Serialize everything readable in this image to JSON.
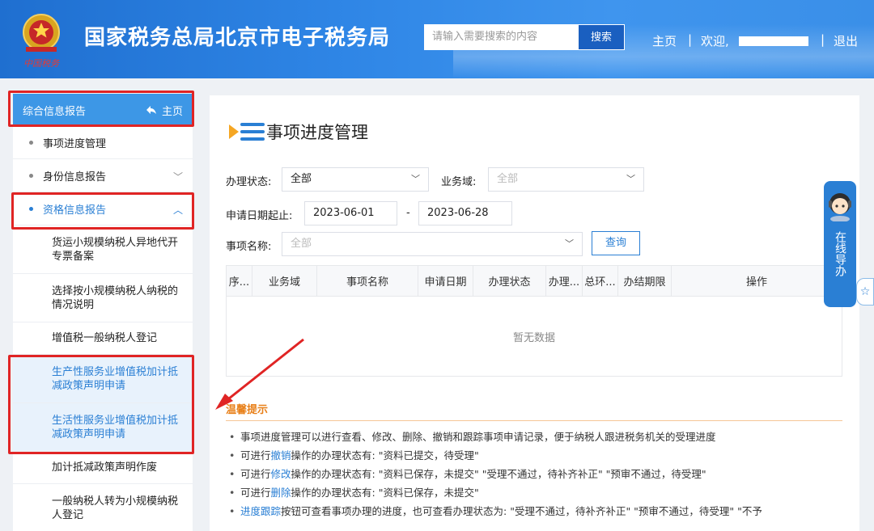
{
  "header": {
    "title": "国家税务总局北京市电子税务局",
    "search_placeholder": "请输入需要搜索的内容",
    "search_button": "搜索",
    "nav_home": "主页",
    "nav_sep": "|",
    "nav_welcome": "欢迎,",
    "nav_logout": "退出",
    "logo_text": "中国税务"
  },
  "sidebar": {
    "head_label": "综合信息报告",
    "head_home": "主页",
    "items": [
      {
        "label": "事项进度管理"
      },
      {
        "label": "身份信息报告"
      },
      {
        "label": "资格信息报告"
      }
    ],
    "sub_items": [
      {
        "label": "货运小规模纳税人异地代开专票备案"
      },
      {
        "label": "选择按小规模纳税人纳税的情况说明"
      },
      {
        "label": "增值税一般纳税人登记"
      },
      {
        "label": "生产性服务业增值税加计抵减政策声明申请"
      },
      {
        "label": "生活性服务业增值税加计抵减政策声明申请"
      },
      {
        "label": "加计抵减政策声明作废"
      },
      {
        "label": "一般纳税人转为小规模纳税人登记"
      }
    ]
  },
  "main": {
    "title": "事项进度管理",
    "status_label": "办理状态:",
    "status_value": "全部",
    "domain_label": "业务域:",
    "domain_placeholder": "全部",
    "date_label": "申请日期起止:",
    "date_start": "2023-06-01",
    "date_sep": "-",
    "date_end": "2023-06-28",
    "item_label": "事项名称:",
    "item_placeholder": "全部",
    "query_button": "查询",
    "table_headers": [
      "序...",
      "业务域",
      "事项名称",
      "申请日期",
      "办理状态",
      "办理...",
      "总环...",
      "办结期限",
      "操作"
    ],
    "empty_text": "暂无数据",
    "tip_title": "温馨提示",
    "tips": [
      {
        "pre": "事项进度管理可以进行查看、修改、删除、撤销和跟踪事项申请记录，便于纳税人跟进税务机关的受理进度",
        "kw": "",
        "post": ""
      },
      {
        "pre": "可进行",
        "kw": "撤销",
        "post": "操作的办理状态有: \"资料已提交，待受理\""
      },
      {
        "pre": "可进行",
        "kw": "修改",
        "post": "操作的办理状态有: \"资料已保存，未提交\"  \"受理不通过，待补齐补正\"  \"预审不通过，待受理\""
      },
      {
        "pre": "可进行",
        "kw": "删除",
        "post": "操作的办理状态有: \"资料已保存，未提交\""
      },
      {
        "pre": "",
        "kw": "进度跟踪",
        "post": "按钮可查看事项办理的进度，也可查看办理状态为: \"受理不通过，待补齐补正\"  \"预审不通过，待受理\"  \"不予"
      }
    ]
  },
  "guide": {
    "text": "在线导办",
    "star": "☆"
  },
  "colors": {
    "accent": "#2a7fd4",
    "header": "#2f86e6",
    "highlight": "#e02424",
    "tip": "#e8801a"
  }
}
